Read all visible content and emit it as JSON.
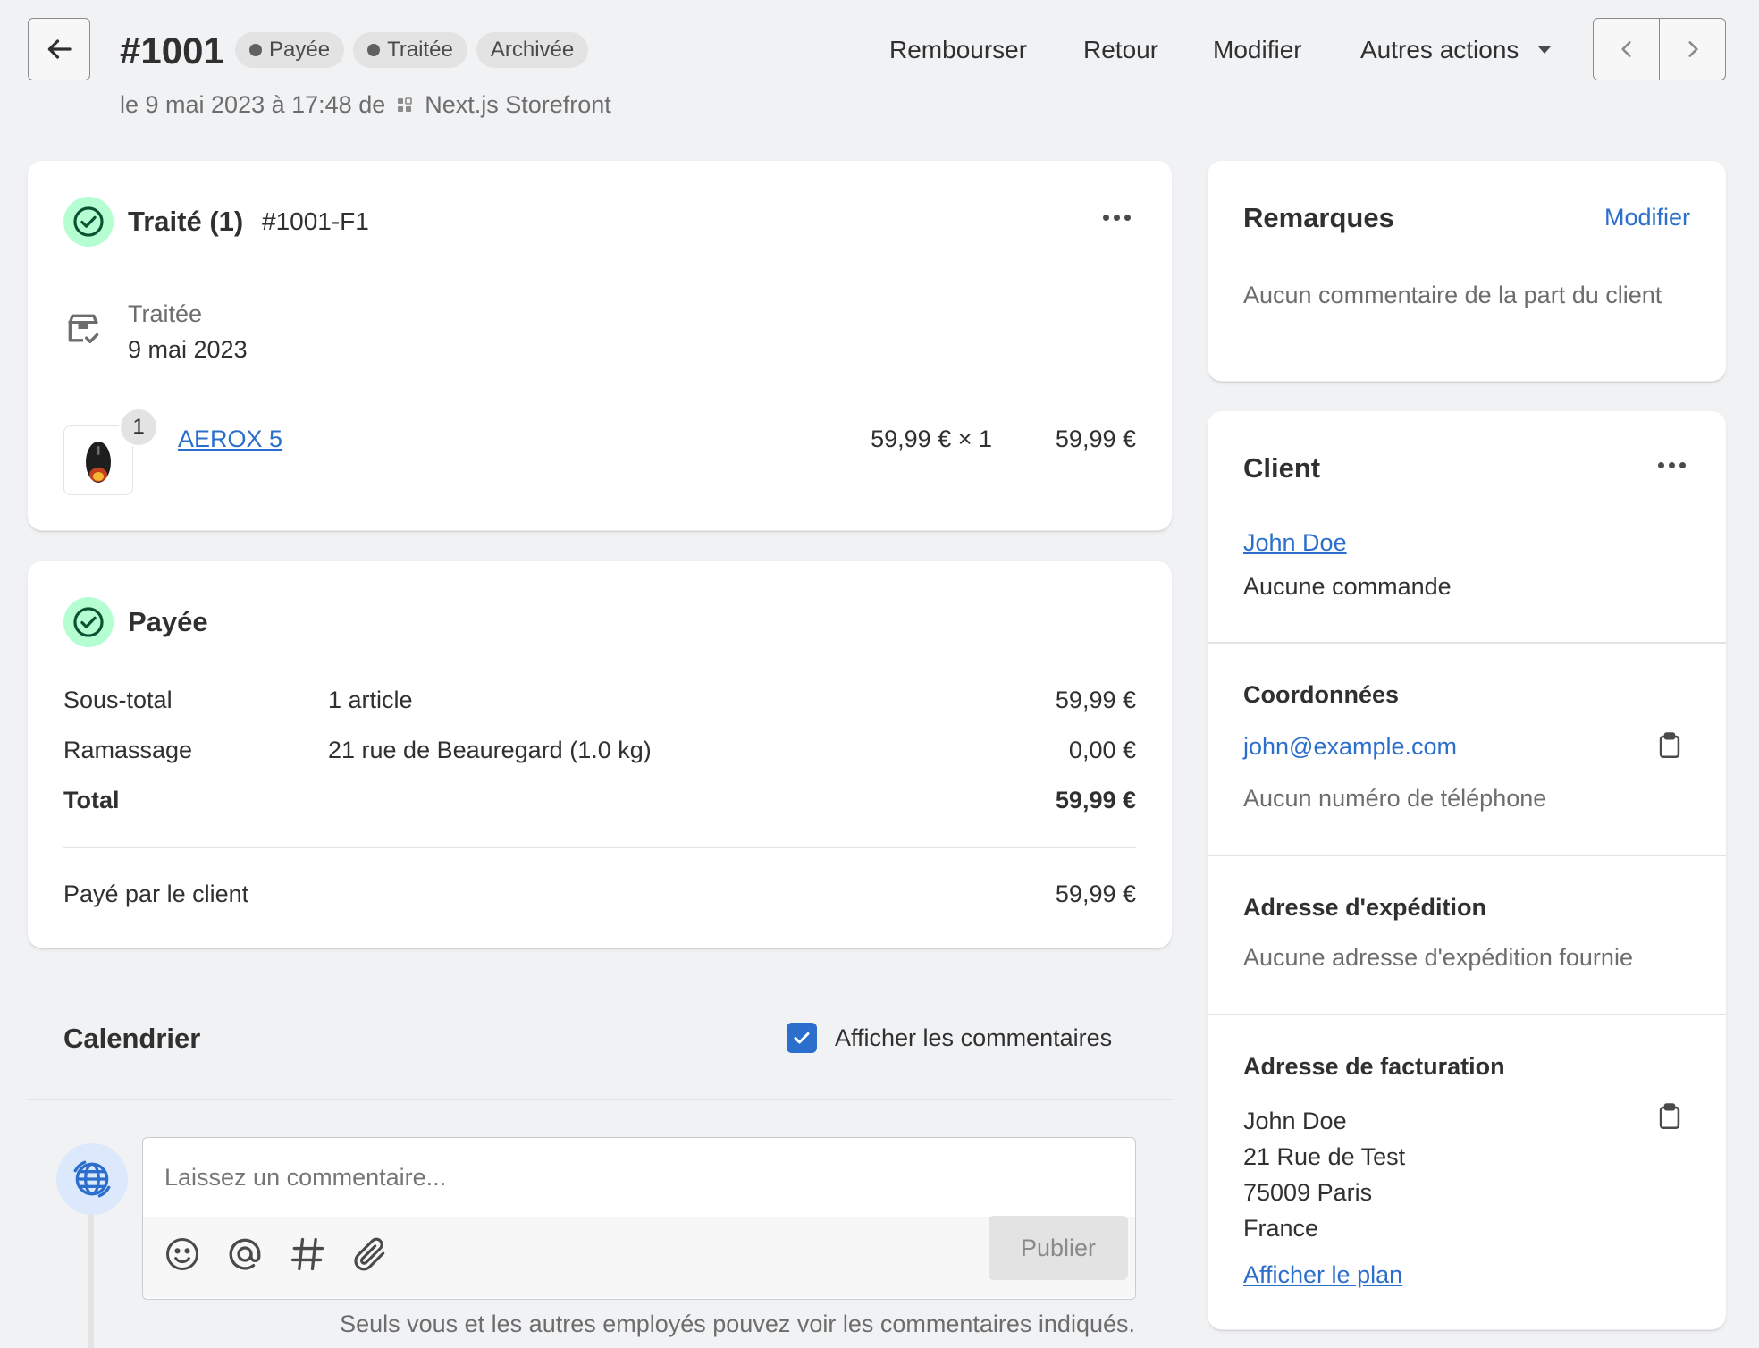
{
  "header": {
    "order_number": "#1001",
    "badges": [
      "Payée",
      "Traitée",
      "Archivée"
    ],
    "date_text": "le 9 mai 2023 à 17:48 de",
    "channel": "Next.js Storefront",
    "actions": {
      "refund": "Rembourser",
      "return": "Retour",
      "edit": "Modifier",
      "more": "Autres actions"
    }
  },
  "fulfillment": {
    "title": "Traité (1)",
    "code": "#1001-F1",
    "status_label": "Traitée",
    "status_date": "9 mai 2023",
    "item": {
      "quantity_badge": "1",
      "name": "AEROX 5",
      "unit_price": "59,99 € × 1",
      "total": "59,99 €"
    }
  },
  "payment": {
    "title": "Payée",
    "rows": [
      {
        "label": "Sous-total",
        "detail": "1 article",
        "amount": "59,99 €"
      },
      {
        "label": "Ramassage",
        "detail": "21 rue de Beauregard (1.0 kg)",
        "amount": "0,00 €"
      },
      {
        "label": "Total",
        "detail": "",
        "amount": "59,99 €"
      }
    ],
    "paid_label": "Payé par le client",
    "paid_amount": "59,99 €"
  },
  "timeline": {
    "title": "Calendrier",
    "show_comments_label": "Afficher les commentaires",
    "show_comments_checked": true,
    "comment_placeholder": "Laissez un commentaire...",
    "publish_label": "Publier",
    "note": "Seuls vous et les autres employés pouvez voir les commentaires indiqués."
  },
  "notes": {
    "title": "Remarques",
    "edit_label": "Modifier",
    "text": "Aucun commentaire de la part du client"
  },
  "customer": {
    "title": "Client",
    "name": "John Doe",
    "orders": "Aucune commande",
    "contact": {
      "title": "Coordonnées",
      "email": "john@example.com",
      "phone": "Aucun numéro de téléphone"
    },
    "shipping": {
      "title": "Adresse d'expédition",
      "text": "Aucune adresse d'expédition fournie"
    },
    "billing": {
      "title": "Adresse de facturation",
      "lines": [
        "John Doe",
        "21 Rue de Test",
        "75009 Paris",
        "France"
      ],
      "map_link": "Afficher le plan"
    }
  },
  "colors": {
    "background": "#f1f2f4",
    "link": "#2c6ecb",
    "success_bg": "#b4fed2",
    "success_icon": "#0c5132",
    "badge_bg": "#e3e3e3"
  }
}
